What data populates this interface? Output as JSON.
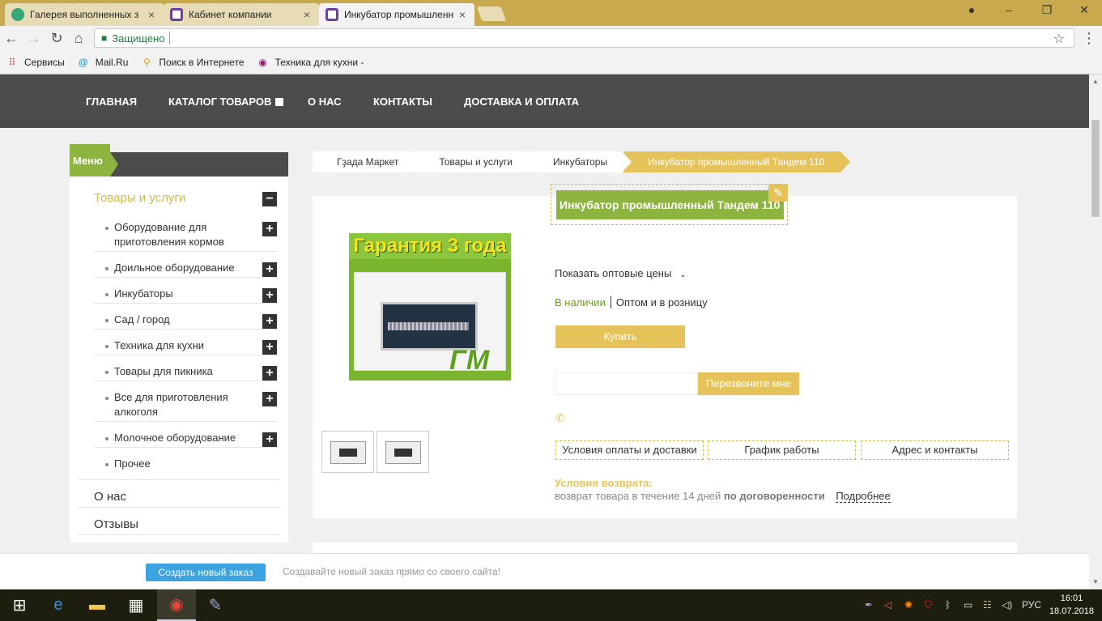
{
  "browser": {
    "tabs": [
      {
        "label": "Галерея выполненных з",
        "icon": "vk-green-icon",
        "color": "#35a675"
      },
      {
        "label": "Кабинет компании",
        "icon": "purple-square-icon",
        "color": "#6b3fa0"
      },
      {
        "label": "Инкубатор промышленн",
        "icon": "purple-square-icon",
        "color": "#6b3fa0"
      }
    ],
    "address": {
      "secure_label": "Защищено",
      "url": ""
    },
    "bookmarks": [
      {
        "label": "Сервисы",
        "icon": "apps-grid-icon"
      },
      {
        "label": "Mail.Ru",
        "icon": "mailru-icon"
      },
      {
        "label": "Поиск в Интернете",
        "icon": "search-icon"
      },
      {
        "label": "Техника для кухни -",
        "icon": "purple-circle-icon"
      }
    ]
  },
  "nav": {
    "items": [
      "ГЛАВНАЯ",
      "КАТАЛОГ ТОВАРОВ",
      "О НАС",
      "КОНТАКТЫ",
      "ДОСТАВКА И ОПЛАТА"
    ]
  },
  "sidebar": {
    "title": "Меню",
    "section": "Товары и услуги",
    "subitems": [
      "Оборудование для приготовления кормов",
      "Доильное оборудование",
      "Инкубаторы",
      "Сад / город",
      "Техника для кухни",
      "Товары для пикника",
      "Все для приготовления алкоголя",
      "Молочное оборудование",
      "Прочее"
    ],
    "main_items": [
      "О нас",
      "Отзывы"
    ]
  },
  "breadcrumb": [
    "Гҙада Маркет",
    "Товары и услуги",
    "Инкубаторы",
    "Инкубатор промышленный Тандем 110"
  ],
  "product": {
    "title": "Инкубатор промышленный Тандем 110",
    "banner": "Гарантия 3 года",
    "logo": "ГМ",
    "wholesale": "Показать оптовые цены",
    "stock": "В наличии",
    "sale_type": "Оптом и в розницу",
    "buy": "Купить",
    "callback": "Перезвоните мне",
    "info_buttons": [
      "Условия оплаты и доставки",
      "График работы",
      "Адрес и контакты"
    ],
    "return_title": "Условия возврата:",
    "return_text": "возврат товара в течение 14 дней",
    "return_bold": "по договоренности",
    "return_more": "Подробнее"
  },
  "promo": {
    "button": "Создать новый заказ",
    "text": "Создавайте новый заказ прямо со своего сайта!"
  },
  "taskbar": {
    "lang": "РУС",
    "time": "16:01",
    "date": "18.07.2018"
  },
  "colors": {
    "accent": "#e6c35a",
    "green": "#8db43e",
    "dark": "#4c4c4c"
  }
}
